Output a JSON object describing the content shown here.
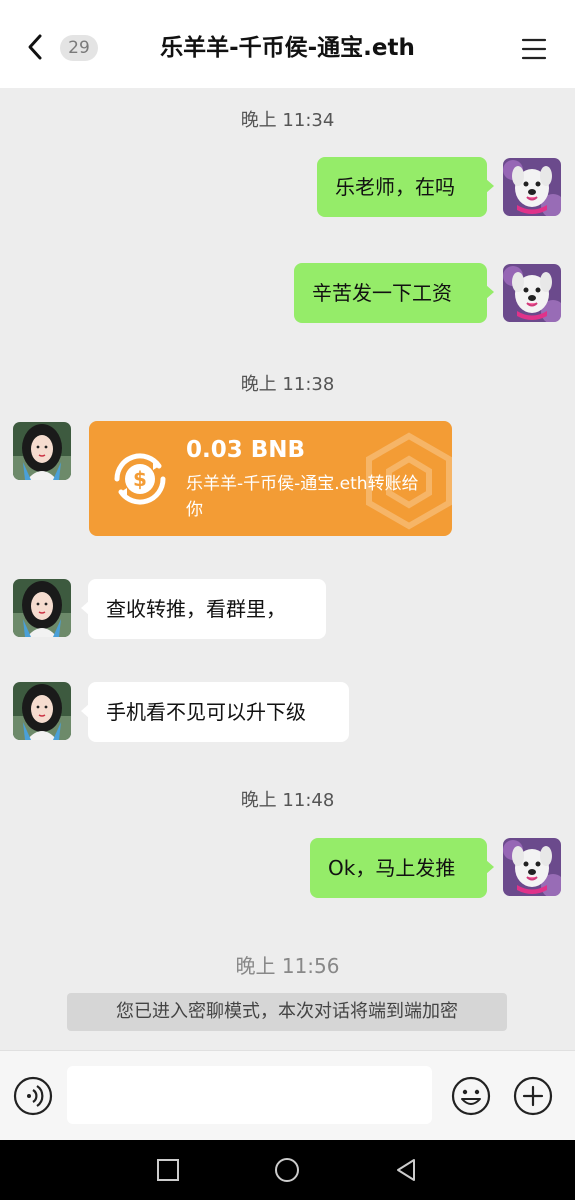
{
  "header": {
    "unread_count": "29",
    "title": "乐羊羊-千币侯-通宝.eth"
  },
  "messages": {
    "time1": "晚上 11:34",
    "msg1": "乐老师，在吗",
    "msg2": "辛苦发一下工资",
    "time2": "晚上 11:38",
    "transfer": {
      "amount": "0.03 BNB",
      "description": "乐羊羊-千币侯-通宝.eth转账给你"
    },
    "msg3": "查收转推，看群里，",
    "msg4": "手机看不见可以升下级",
    "time3": "晚上 11:48",
    "msg5": "Ok，马上发推",
    "time4": "晚上 11:56",
    "notice": "您已进入密聊模式，本次对话将端到端加密"
  },
  "input_bar": {
    "placeholder": ""
  },
  "colors": {
    "outgoing_bubble": "#95ec69",
    "incoming_bubble": "#ffffff",
    "transfer_card": "#f39c35",
    "background": "#ededed"
  }
}
